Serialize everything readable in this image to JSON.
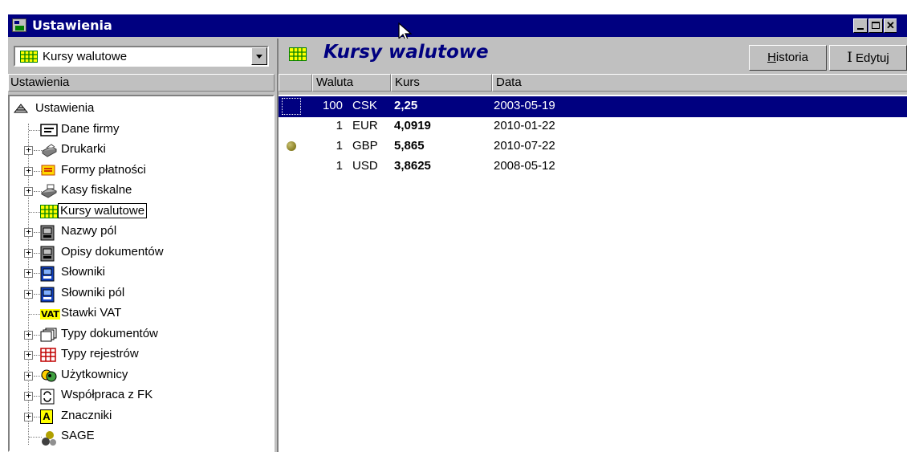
{
  "window": {
    "title": "Ustawienia"
  },
  "colors": {
    "titlebar": "#000080",
    "selection": "#000080",
    "face": "#c0c0c0"
  },
  "left": {
    "combo_value": "Kursy walutowe",
    "header": "Ustawienia",
    "tree": [
      {
        "label": "Ustawienia",
        "icon": "settings-root-icon",
        "expandable": false,
        "root": true
      },
      {
        "label": "Dane firmy",
        "icon": "company-card-icon",
        "expandable": false
      },
      {
        "label": "Drukarki",
        "icon": "printer-icon",
        "expandable": true
      },
      {
        "label": "Formy płatności",
        "icon": "payment-forms-icon",
        "expandable": true
      },
      {
        "label": "Kasy fiskalne",
        "icon": "cash-register-icon",
        "expandable": true
      },
      {
        "label": "Kursy walutowe",
        "icon": "exchange-grid-icon",
        "expandable": false,
        "selected": true
      },
      {
        "label": "Nazwy pól",
        "icon": "field-names-icon",
        "expandable": true
      },
      {
        "label": "Opisy dokumentów",
        "icon": "doc-descriptions-icon",
        "expandable": true
      },
      {
        "label": "Słowniki",
        "icon": "dictionary-icon",
        "expandable": true
      },
      {
        "label": "Słowniki pól",
        "icon": "field-dictionary-icon",
        "expandable": true
      },
      {
        "label": "Stawki VAT",
        "icon": "vat-icon",
        "expandable": false
      },
      {
        "label": "Typy dokumentów",
        "icon": "doc-types-icon",
        "expandable": true
      },
      {
        "label": "Typy rejestrów",
        "icon": "register-types-icon",
        "expandable": true
      },
      {
        "label": "Użytkownicy",
        "icon": "users-icon",
        "expandable": true
      },
      {
        "label": "Współpraca z FK",
        "icon": "fk-sync-icon",
        "expandable": true
      },
      {
        "label": "Znaczniki",
        "icon": "markers-icon",
        "expandable": true
      },
      {
        "label": "SAGE",
        "icon": "sage-icon",
        "expandable": false
      }
    ],
    "vat_icon_text": "VAT",
    "markers_icon_text": "A"
  },
  "right": {
    "title": "Kursy walutowe",
    "historia_label": "Historia",
    "edytuj_label": "Edytuj",
    "columns": {
      "waluta": "Waluta",
      "kurs": "Kurs",
      "data": "Data"
    },
    "rows": [
      {
        "qty": "100",
        "currency": "CSK",
        "rate": "2,25",
        "date": "2003-05-19",
        "selected": true,
        "marker": false
      },
      {
        "qty": "1",
        "currency": "EUR",
        "rate": "4,0919",
        "date": "2010-01-22",
        "selected": false,
        "marker": false
      },
      {
        "qty": "1",
        "currency": "GBP",
        "rate": "5,865",
        "date": "2010-07-22",
        "selected": false,
        "marker": true
      },
      {
        "qty": "1",
        "currency": "USD",
        "rate": "3,8625",
        "date": "2008-05-12",
        "selected": false,
        "marker": false
      }
    ]
  }
}
